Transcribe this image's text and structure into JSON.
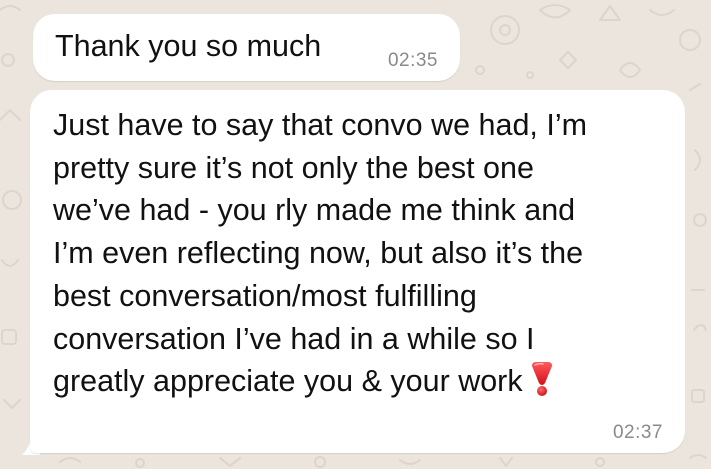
{
  "chat": {
    "background_color": "#ece5dd",
    "bubble_color": "#ffffff",
    "messages": [
      {
        "text": "Thank you so much",
        "time": "02:35"
      },
      {
        "text": "Just have to say that convo we had, I’m\npretty sure it’s not only the best one\nwe’ve had - you rly made me think and\nI’m even reflecting now, but also it’s the\nbest conversation/most fulfilling\nconversation I’ve had in a while so I\ngreatly appreciate you & your work",
        "emoji": "heavy-exclamation-mark-icon",
        "time": "02:37"
      }
    ]
  }
}
